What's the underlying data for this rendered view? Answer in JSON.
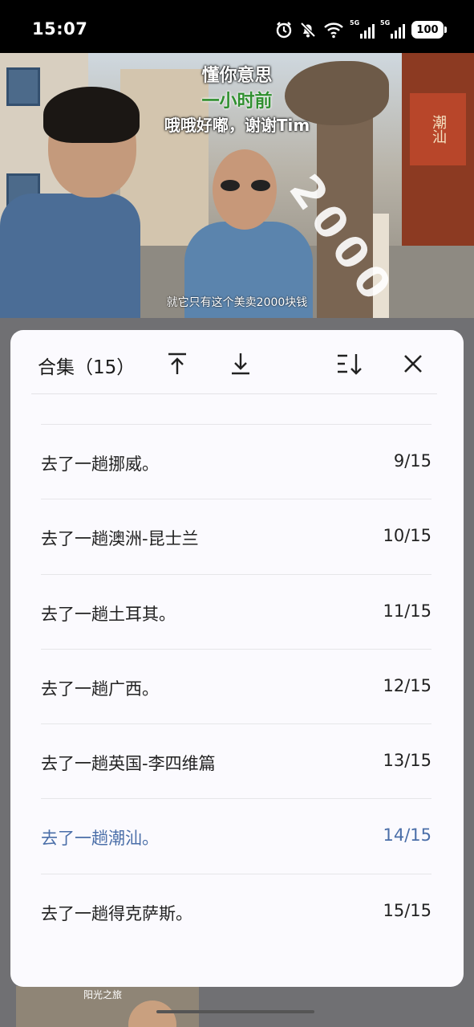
{
  "status_bar": {
    "time": "15:07",
    "signal1_label": "5G",
    "signal2_label": "5G",
    "battery": "100",
    "icons": [
      "alarm-icon",
      "mute-bell-icon",
      "wifi-icon",
      "signal-icon",
      "signal-icon",
      "battery-icon"
    ]
  },
  "video": {
    "caption_line1": "懂你意思",
    "caption_line2": "一小时前",
    "caption_line3": "哦哦好嘟，谢谢Tim",
    "overlay_number": "2000",
    "subtitle": "就它只有这个美卖2000块钱",
    "shop_sign": "潮汕"
  },
  "collection": {
    "title": "合集（15）",
    "actions": {
      "scroll_top": "arrow-to-top-icon",
      "scroll_bottom": "arrow-to-bottom-icon",
      "sort": "sort-icon",
      "close": "close-icon"
    },
    "active_color": "#4a6ea8",
    "items": [
      {
        "title": "去了一趟挪威。",
        "index": "9/15",
        "active": false
      },
      {
        "title": "去了一趟澳洲-昆士兰",
        "index": "10/15",
        "active": false
      },
      {
        "title": "去了一趟土耳其。",
        "index": "11/15",
        "active": false
      },
      {
        "title": "去了一趟广西。",
        "index": "12/15",
        "active": false
      },
      {
        "title": "去了一趟英国-李四维篇",
        "index": "13/15",
        "active": false
      },
      {
        "title": "去了一趟潮汕。",
        "index": "14/15",
        "active": true
      },
      {
        "title": "去了一趟得克萨斯。",
        "index": "15/15",
        "active": false
      }
    ]
  },
  "bottom_peek": {
    "thumb_title": "阳光之旅"
  }
}
